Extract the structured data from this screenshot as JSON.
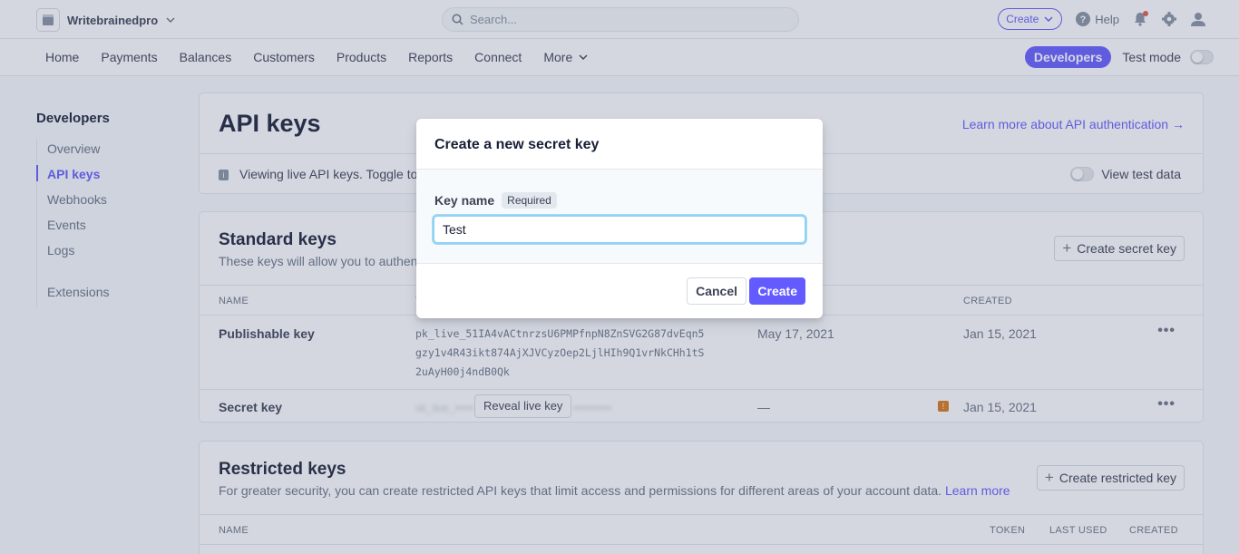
{
  "topbar": {
    "account_name": "Writebrainedpro",
    "search_placeholder": "Search...",
    "create_label": "Create",
    "help_label": "Help"
  },
  "nav": {
    "items": [
      "Home",
      "Payments",
      "Balances",
      "Customers",
      "Products",
      "Reports",
      "Connect"
    ],
    "more_label": "More",
    "developers_label": "Developers",
    "test_mode_label": "Test mode"
  },
  "sidebar": {
    "title": "Developers",
    "items": [
      "Overview",
      "API keys",
      "Webhooks",
      "Events",
      "Logs"
    ],
    "extensions_label": "Extensions"
  },
  "page": {
    "title": "API keys",
    "learn_more": "Learn more about API authentication →",
    "info_text": "Viewing live API keys. Toggle to",
    "view_test_data": "View test data"
  },
  "standard_keys": {
    "title": "Standard keys",
    "subtitle": "These keys will allow you to authent",
    "create_button": "Create secret key",
    "columns": {
      "name": "NAME",
      "token": "T",
      "created": "CREATED"
    },
    "publishable": {
      "name": "Publishable key",
      "token_line1": "pk_live_51IA4vACtnrzsU6PMPfnpN8ZnSVG2G87dvEqn5",
      "token_line2": "gzy1v4R43ikt874AjXJVCyzOep2LjlHIh9Q1vrNkCHh1tS",
      "token_line3": "2uAyH00j4ndB0Qk",
      "last_used": "May 17, 2021",
      "created": "Jan 15, 2021"
    },
    "secret": {
      "name": "Secret key",
      "reveal_label": "Reveal live key",
      "last_used": "—",
      "created": "Jan 15, 2021"
    }
  },
  "restricted_keys": {
    "title": "Restricted keys",
    "subtitle": "For greater security, you can create restricted API keys that limit access and permissions for different areas of your account data.",
    "learn_more": "Learn more",
    "create_button": "Create restricted key",
    "columns": {
      "name": "NAME",
      "token": "TOKEN",
      "last_used": "LAST USED",
      "created": "CREATED"
    }
  },
  "modal": {
    "title": "Create a new secret key",
    "field_label": "Key name",
    "required_badge": "Required",
    "field_value": "Test",
    "cancel_label": "Cancel",
    "create_label": "Create"
  },
  "colors": {
    "accent": "#635bff",
    "warning": "#d97917"
  }
}
